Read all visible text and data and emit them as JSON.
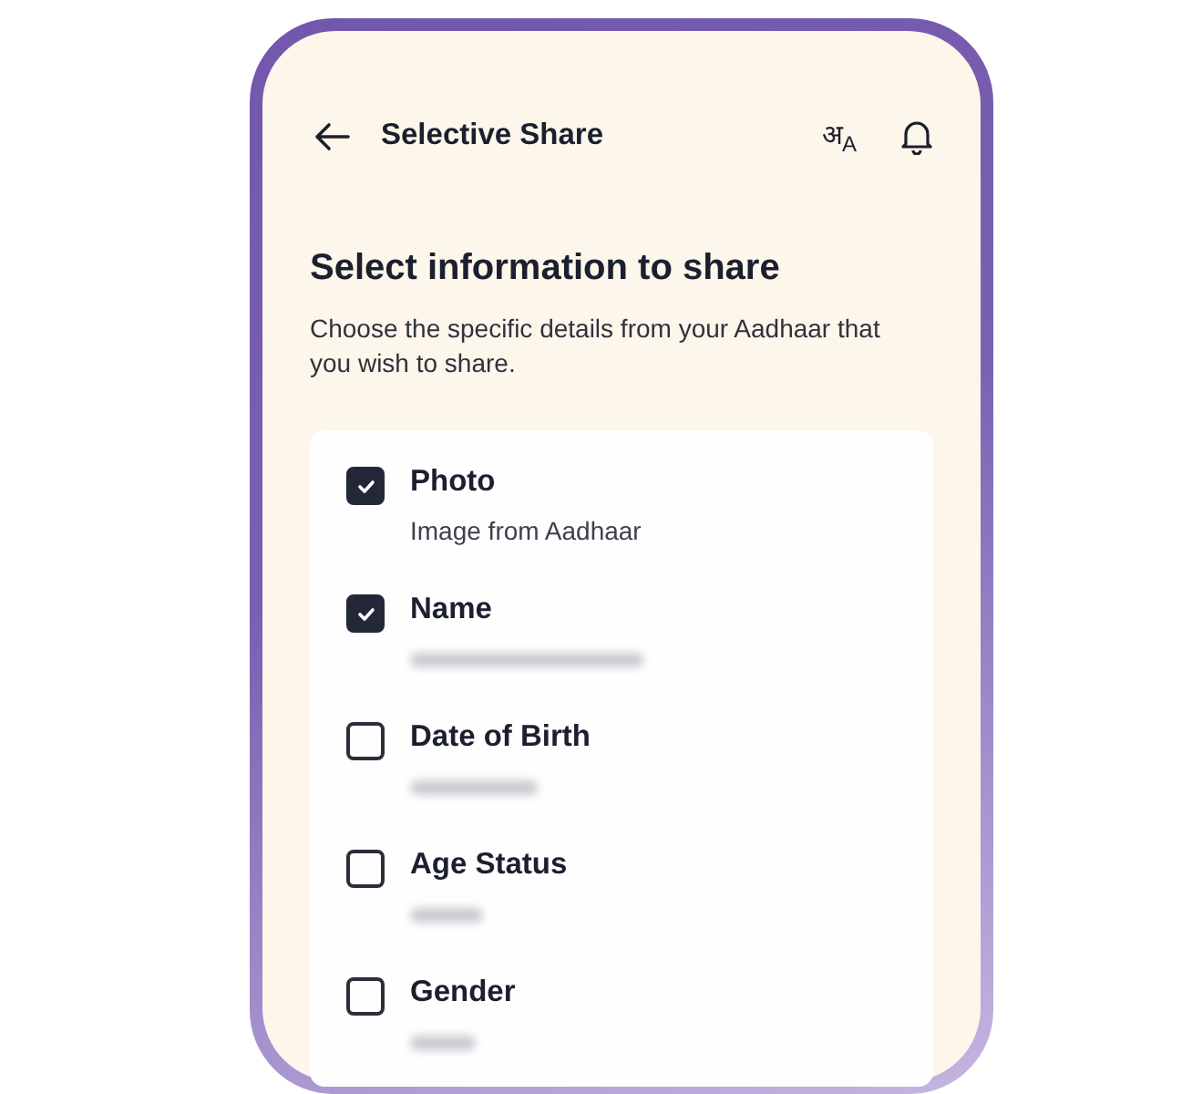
{
  "header": {
    "title": "Selective Share",
    "language": "अ$_{A}$"
  },
  "heading": "Select information to share",
  "description": "Choose the specific details from your Aadhaar that you wish to share.",
  "fields": [
    {
      "label": "Photo",
      "checked": true,
      "detail": "Image from Aadhaar"
    },
    {
      "label": "Name",
      "checked": true,
      "detail_blurred": true
    },
    {
      "label": "Date of Birth",
      "checked": false,
      "detail_blurred": true
    },
    {
      "label": "Age Status",
      "checked": false,
      "detail_blurred": true
    },
    {
      "label": "Gender",
      "checked": false,
      "detail_blurred": true
    }
  ]
}
